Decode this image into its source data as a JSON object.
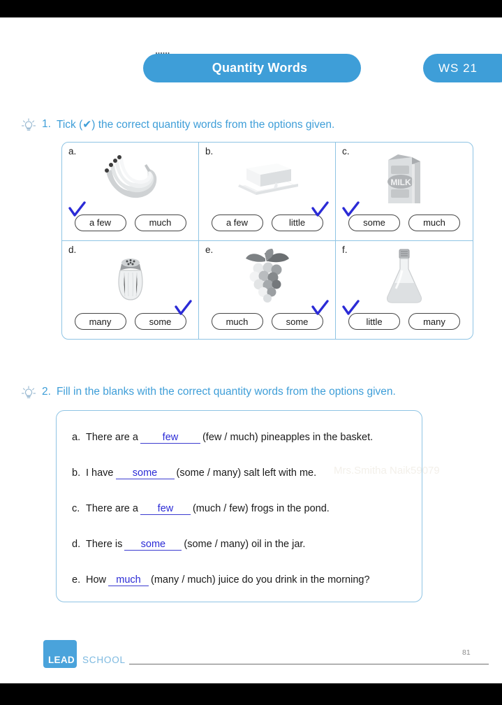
{
  "header": {
    "title": "Quantity Words",
    "worksheet_badge": "WS  21",
    "icon": "notepad-icon",
    "accent_color": "#3e9ed8"
  },
  "questions": [
    {
      "number": "1.",
      "text": "Tick (✔) the correct quantity words from the options given."
    },
    {
      "number": "2.",
      "text": "Fill in the blanks with the correct quantity words from the options given."
    }
  ],
  "tick_exercise": {
    "cells": [
      {
        "label": "a.",
        "image": "bananas-image",
        "options": [
          "a few",
          "much"
        ],
        "ticked_index": 0
      },
      {
        "label": "b.",
        "image": "butter-image",
        "options": [
          "a few",
          "little"
        ],
        "ticked_index": 1
      },
      {
        "label": "c.",
        "image": "milk-carton-image",
        "options": [
          "some",
          "much"
        ],
        "ticked_index": 0
      },
      {
        "label": "d.",
        "image": "salt-shaker-image",
        "options": [
          "many",
          "some"
        ],
        "ticked_index": 1
      },
      {
        "label": "e.",
        "image": "grapes-image",
        "options": [
          "much",
          "some"
        ],
        "ticked_index": 1
      },
      {
        "label": "f.",
        "image": "oil-flask-image",
        "options": [
          "little",
          "many"
        ],
        "ticked_index": 0
      }
    ],
    "tick_color": "#2b2bd6",
    "border_color": "#8fc4e4"
  },
  "fill_in_blanks": {
    "items": [
      {
        "letter": "a.",
        "before": "There are a",
        "answer": "few",
        "after": "(few / much) pineapples in the basket."
      },
      {
        "letter": "b.",
        "before": "I have",
        "answer": "some",
        "after": "(some / many) salt left with me."
      },
      {
        "letter": "c.",
        "before": "There are a",
        "answer": "few",
        "after": "(much / few) frogs in the pond."
      },
      {
        "letter": "d.",
        "before": "There is",
        "answer": "some",
        "after": "(some / many) oil in the jar."
      },
      {
        "letter": "e.",
        "before": "How",
        "answer": "much",
        "after": "(many / much) juice do you drink in the morning?"
      }
    ],
    "answer_color": "#2b2bd6"
  },
  "watermark": "Mrs.Smitha Naik59079",
  "footer": {
    "logo_primary": "LEAD",
    "logo_secondary": "SCHOOL",
    "page_number": "81"
  }
}
